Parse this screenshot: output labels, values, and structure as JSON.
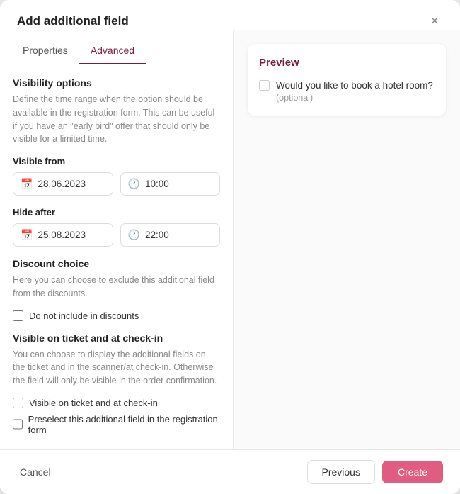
{
  "modal": {
    "title": "Add additional field",
    "close_label": "×"
  },
  "tabs": [
    {
      "id": "properties",
      "label": "Properties",
      "active": false
    },
    {
      "id": "advanced",
      "label": "Advanced",
      "active": true
    }
  ],
  "advanced": {
    "visibility_options": {
      "title": "Visibility options",
      "description": "Define the time range when the option should be available in the registration form. This can be useful if you have an \"early bird\" offer that should only be visible for a limited time."
    },
    "visible_from": {
      "label": "Visible from",
      "date_value": "28.06.2023",
      "time_value": "10:00"
    },
    "hide_after": {
      "label": "Hide after",
      "date_value": "25.08.2023",
      "time_value": "22:00"
    },
    "discount_choice": {
      "title": "Discount choice",
      "description": "Here you can choose to exclude this additional field from the discounts.",
      "checkbox_label": "Do not include in discounts"
    },
    "visible_on_ticket": {
      "title": "Visible on ticket and at check-in",
      "description": "You can choose to display the additional fields on the ticket and in the scanner/at check-in. Otherwise the field will only be visible in the order confirmation.",
      "checkbox1_label": "Visible on ticket and at check-in",
      "checkbox2_label": "Preselect this additional field in the registration form"
    }
  },
  "preview": {
    "title": "Preview",
    "field_text": "Would you like to book a hotel room?",
    "optional_text": "(optional)"
  },
  "footer": {
    "cancel_label": "Cancel",
    "previous_label": "Previous",
    "create_label": "Create"
  }
}
